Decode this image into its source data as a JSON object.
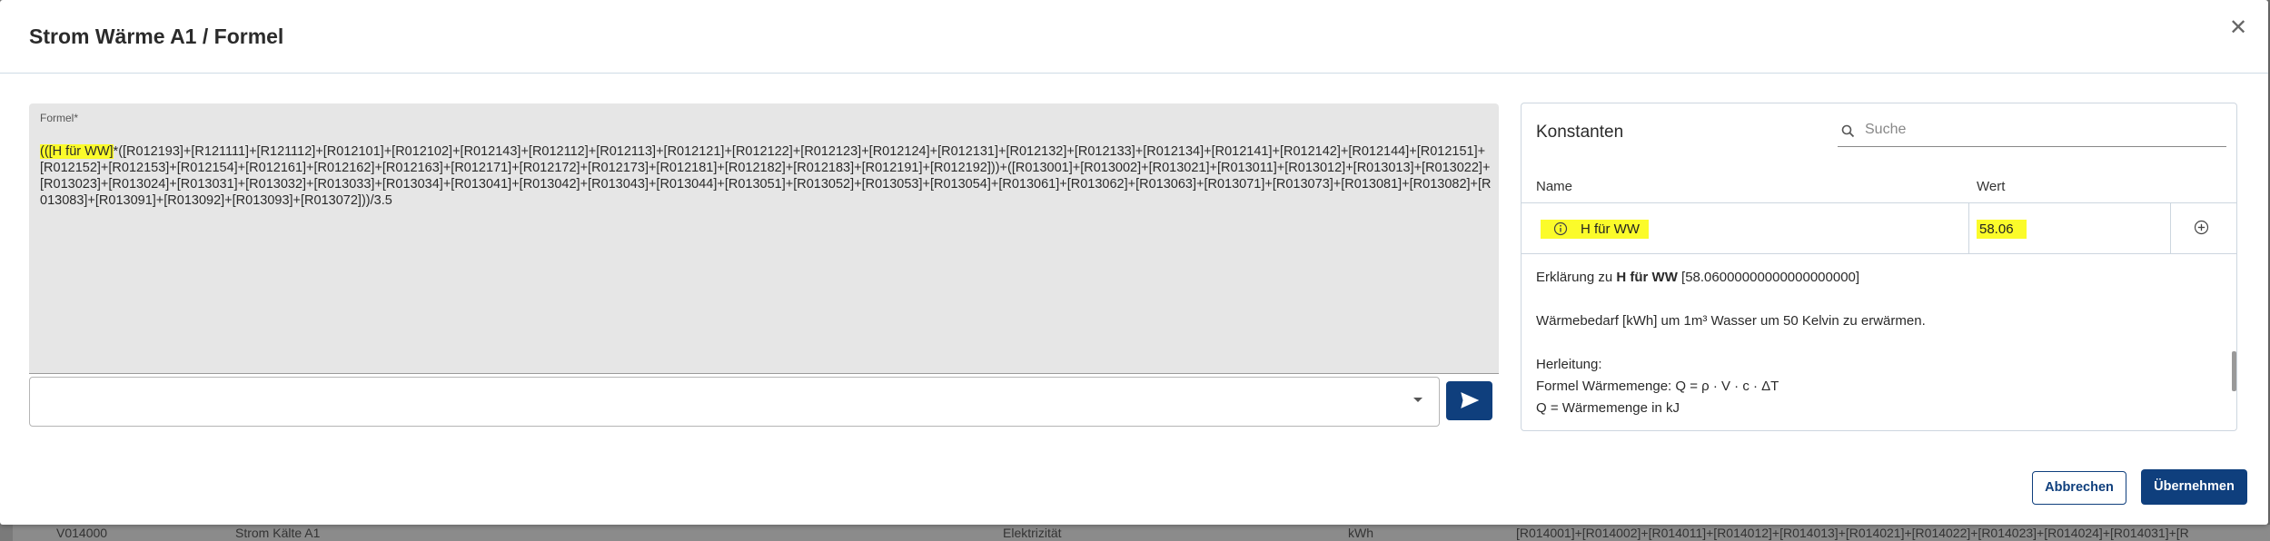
{
  "dialog": {
    "title": "Strom Wärme A1 / Formel",
    "close_icon": "close-icon"
  },
  "formula": {
    "label": "Formel*",
    "highlighted_prefix": "(([H für WW]",
    "text_rest": "*([R012193]+[R121111]+[R121112]+[R012101]+[R012102]+[R012143]+[R012112]+[R012113]+[R012121]+[R012122]+[R012123]+[R012124]+[R012131]+[R012132]+[R012133]+[R012134]+[R012141]+[R012142]+[R012144]+[R012151]+[R012152]+[R012153]+[R012154]+[R012161]+[R012162]+[R012163]+[R012171]+[R012172]+[R012173]+[R012181]+[R012182]+[R012183]+[R012191]+[R012192]))+([R013001]+[R013002]+[R013021]+[R013011]+[R013012]+[R013013]+[R013022]+[R013023]+[R013024]+[R013031]+[R013032]+[R013033]+[R013034]+[R013041]+[R013042]+[R013043]+[R013044]+[R013051]+[R013052]+[R013053]+[R013054]+[R013061]+[R013062]+[R013063]+[R013071]+[R013073]+[R013081]+[R013082]+[R013083]+[R013091]+[R013092]+[R013093]+[R013072]))/3.5",
    "input_value": "",
    "send_icon": "send-icon"
  },
  "constants": {
    "title": "Konstanten",
    "search_placeholder": "Suche",
    "columns": {
      "name": "Name",
      "value": "Wert"
    },
    "row": {
      "name": "H für WW",
      "value": "58.06",
      "info_icon": "info-icon",
      "add_icon": "add-circle-icon"
    },
    "explanation": {
      "prefix": "Erklärung zu ",
      "name": "H für WW",
      "value": " [58.06000000000000000000]",
      "line1": "Wärmebedarf [kWh] um 1m³ Wasser um 50 Kelvin zu erwärmen.",
      "line2": "Herleitung:",
      "line3": "Formel Wärmemenge: Q = ρ · V · c · ΔT",
      "line4": "Q = Wärmemenge in kJ"
    }
  },
  "buttons": {
    "cancel": "Abbrechen",
    "apply": "Übernehmen"
  },
  "background": {
    "row_code": "V014000",
    "row_name": "Strom Kälte A1",
    "row_type": "Elektrizität",
    "row_unit": "kWh",
    "row_formula": "[R014001]+[R014002]+[R014011]+[R014012]+[R014013]+[R014021]+[R014022]+[R014023]+[R014024]+[R014031]+[R"
  },
  "colors": {
    "primary": "#0f3f7d",
    "highlight": "#fbfb2a",
    "formula_bg": "#e6e6e6"
  }
}
